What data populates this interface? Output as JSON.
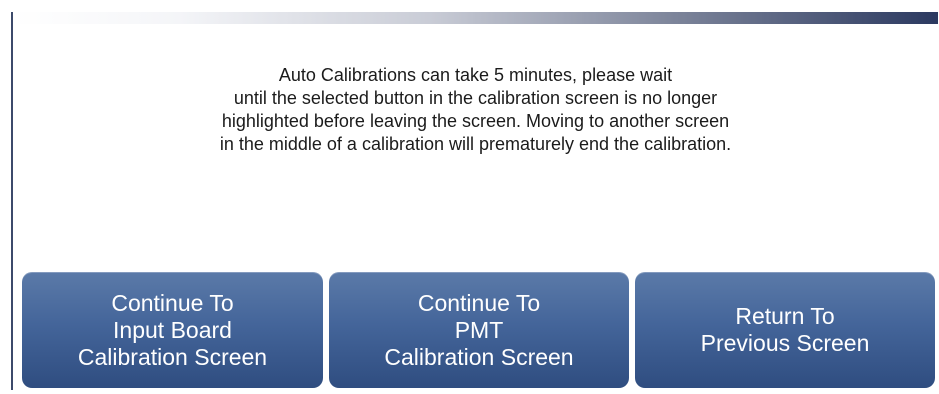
{
  "message": {
    "lines": [
      "Auto Calibrations can take 5 minutes, please wait",
      "until the selected button in the calibration screen is no longer",
      "highlighted before leaving the screen. Moving to another screen",
      "in the middle of a calibration will prematurely end the calibration."
    ]
  },
  "buttons": [
    {
      "lines": [
        "Continue To",
        "Input Board",
        "Calibration Screen"
      ]
    },
    {
      "lines": [
        "Continue To",
        "PMT",
        "Calibration Screen"
      ]
    },
    {
      "lines": [
        "Return To",
        "Previous Screen"
      ]
    }
  ],
  "colors": {
    "button_top": "#5b7aa8",
    "button_bottom": "#2f4d80",
    "button_text": "#ffffff",
    "header_bar_dark": "#2b3960",
    "message_text": "#1b1b1b"
  }
}
